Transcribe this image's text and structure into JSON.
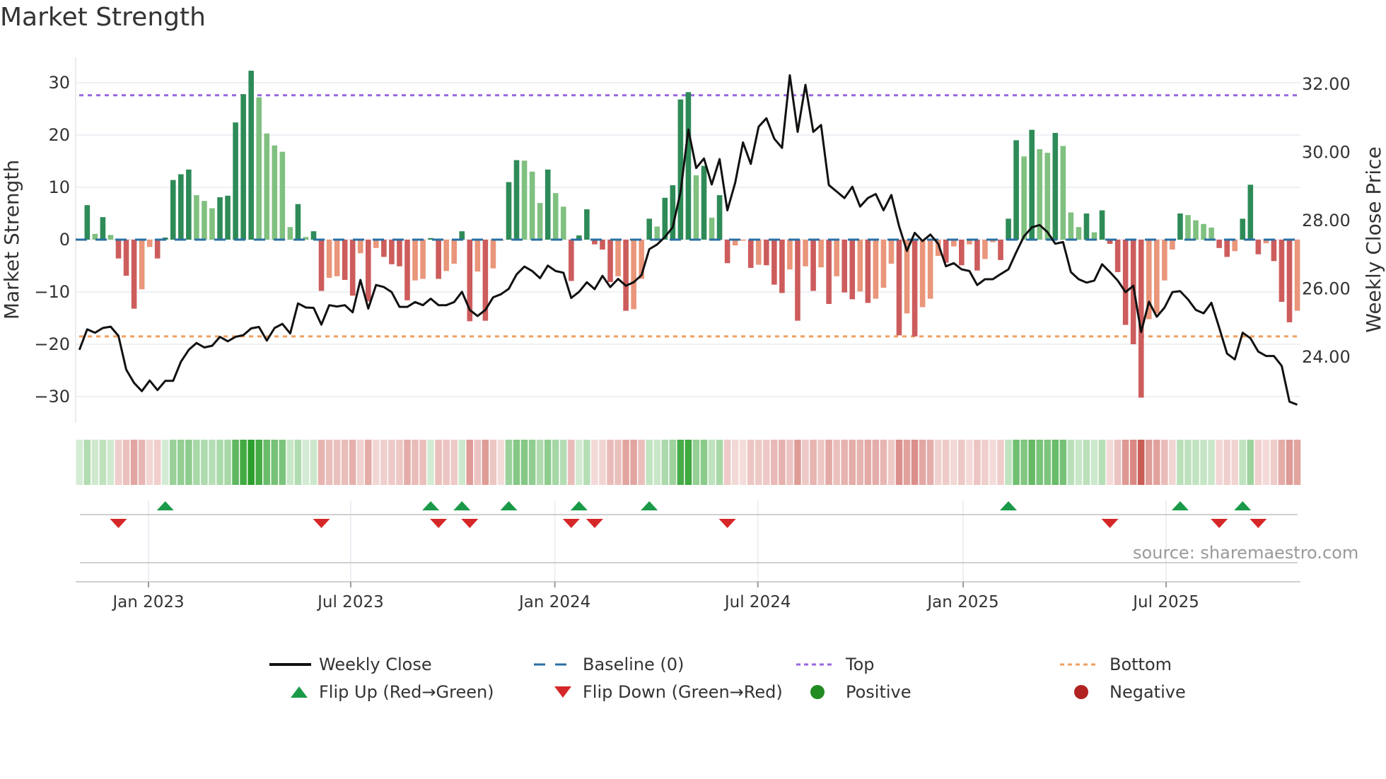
{
  "title": "Market Strength",
  "source": "source: sharemaestro.com",
  "colors": {
    "bar_pos_up": "#2e8b57",
    "bar_pos_down": "#80c080",
    "bar_neg_down": "#cd5c5c",
    "bar_neg_up": "#e9967a",
    "close_line": "#111111",
    "baseline": "#2a6fa3",
    "top": "#9966dd",
    "bottom": "#f0a060",
    "flip_up": "#1a9a48",
    "flip_down": "#d62728",
    "positive": "#228b22",
    "negative": "#b22222",
    "heat_green": "#2ca02c",
    "heat_red": "#c8564e"
  },
  "legend": [
    {
      "label": "Weekly Close",
      "symbol": "line"
    },
    {
      "label": "Baseline (0)",
      "symbol": "dash"
    },
    {
      "label": "Top",
      "symbol": "dot-purple"
    },
    {
      "label": "Bottom",
      "symbol": "dot-orange"
    },
    {
      "label": "Flip Up (Red→Green)",
      "symbol": "triangle-up"
    },
    {
      "label": "Flip Down (Green→Red)",
      "symbol": "triangle-down"
    },
    {
      "label": "Positive",
      "symbol": "dot-green"
    },
    {
      "label": "Negative",
      "symbol": "dot-red"
    }
  ],
  "chart_data": {
    "type": "bar",
    "title": "Market Strength",
    "ylabel": "Market Strength",
    "y2label": "Weekly Close Price",
    "ylim": [
      -38,
      38
    ],
    "yticks": [
      30,
      20,
      10,
      0,
      -10,
      -20,
      -30
    ],
    "ytick_labels": [
      "30",
      "20",
      "10",
      "0",
      "−10",
      "−20",
      "−30"
    ],
    "y2lim": [
      22.45,
      32.38
    ],
    "y2ticks": [
      32,
      30,
      28,
      26,
      24
    ],
    "y2tick_labels": [
      "32.00",
      "30.00",
      "28.00",
      "26.00",
      "24.00"
    ],
    "x_unit": "week",
    "x_ticks": [
      {
        "label": "Jan 2023",
        "week": 8.85
      },
      {
        "label": "Jul 2023",
        "week": 34.75
      },
      {
        "label": "Jan 2024",
        "week": 60.9
      },
      {
        "label": "Jul 2024",
        "week": 86.9
      },
      {
        "label": "Jan 2025",
        "week": 113.2
      },
      {
        "label": "Jul 2025",
        "week": 139.2
      }
    ],
    "top": 27.6,
    "bottom": -18.5,
    "baseline": 0,
    "strength": [
      0.2,
      6.6,
      1.1,
      4.3,
      0.9,
      -3.6,
      -6.9,
      -13.2,
      -9.5,
      -1.4,
      -3.6,
      0.4,
      11.4,
      12.5,
      13.4,
      8.5,
      7.4,
      6.0,
      8.1,
      8.4,
      22.4,
      27.8,
      32.3,
      27.2,
      20.3,
      18.0,
      16.8,
      2.4,
      6.8,
      0.5,
      1.6,
      -9.8,
      -7.3,
      -7.0,
      -7.7,
      -10.7,
      -2.6,
      -11.8,
      -1.6,
      -3.3,
      -4.7,
      -5.1,
      -11.6,
      -7.8,
      -7.5,
      0.3,
      -7.5,
      -6.0,
      -4.6,
      1.6,
      -15.6,
      -6.1,
      -15.5,
      -5.5,
      -0.2,
      11.0,
      15.2,
      15.1,
      13.0,
      7.0,
      13.4,
      8.9,
      6.3,
      -7.9,
      0.8,
      5.8,
      -0.9,
      -1.9,
      -8.1,
      -7.0,
      -13.6,
      -13.3,
      -7.5,
      4.0,
      2.5,
      8.0,
      10.4,
      26.8,
      28.2,
      12.3,
      14.1,
      4.2,
      8.5,
      -4.5,
      -1.1,
      -0.2,
      -5.4,
      -4.8,
      -4.9,
      -8.6,
      -10.2,
      -5.7,
      -15.5,
      -5.1,
      -9.8,
      -5.3,
      -12.3,
      -7.0,
      -10.1,
      -11.4,
      -9.9,
      -12.1,
      -11.3,
      -9.2,
      -4.6,
      -18.3,
      -14.1,
      -18.5,
      -12.9,
      -11.3,
      -3.1,
      -4.4,
      -1.3,
      -4.9,
      -0.9,
      -5.9,
      -3.7,
      -0.5,
      -3.9,
      4.0,
      19.0,
      15.9,
      21.0,
      17.3,
      16.6,
      20.4,
      17.9,
      5.2,
      2.4,
      5.0,
      1.4,
      5.6,
      -0.8,
      -6.2,
      -16.3,
      -20.0,
      -30.2,
      -15.2,
      -14.1,
      -7.8,
      -1.9,
      5.0,
      4.7,
      3.7,
      3.0,
      2.3,
      -1.6,
      -3.3,
      -2.2,
      4.0,
      10.5,
      -2.8,
      -0.7,
      -4.1,
      -11.9,
      -15.8,
      -13.6
    ],
    "weekly_close": [
      24.21,
      24.81,
      24.71,
      24.85,
      24.89,
      24.62,
      23.63,
      23.24,
      23.0,
      23.31,
      23.03,
      23.3,
      23.3,
      23.86,
      24.21,
      24.41,
      24.28,
      24.33,
      24.59,
      24.46,
      24.59,
      24.64,
      24.84,
      24.88,
      24.48,
      24.85,
      24.97,
      24.69,
      25.57,
      25.45,
      25.44,
      24.95,
      25.52,
      25.48,
      25.52,
      25.31,
      26.26,
      25.42,
      26.11,
      26.05,
      25.9,
      25.47,
      25.47,
      25.61,
      25.52,
      25.71,
      25.52,
      25.52,
      25.61,
      25.91,
      25.38,
      25.2,
      25.38,
      25.75,
      25.84,
      26.0,
      26.42,
      26.65,
      26.52,
      26.31,
      26.68,
      26.52,
      26.47,
      25.73,
      25.91,
      26.19,
      25.99,
      26.38,
      26.05,
      26.29,
      26.09,
      26.19,
      26.4,
      27.16,
      27.3,
      27.52,
      27.8,
      28.84,
      30.67,
      29.54,
      29.82,
      29.06,
      29.8,
      28.3,
      29.11,
      30.29,
      29.66,
      30.75,
      31.0,
      30.4,
      30.13,
      32.26,
      30.6,
      31.98,
      30.6,
      30.8,
      29.04,
      28.85,
      28.66,
      28.99,
      28.41,
      28.66,
      28.78,
      28.3,
      28.75,
      27.83,
      27.11,
      27.64,
      27.4,
      27.59,
      27.32,
      26.66,
      26.75,
      26.57,
      26.52,
      26.11,
      26.28,
      26.28,
      26.43,
      26.57,
      27.07,
      27.54,
      27.8,
      27.87,
      27.66,
      27.32,
      27.37,
      26.49,
      26.28,
      26.18,
      26.24,
      26.72,
      26.49,
      26.24,
      25.9,
      26.09,
      24.73,
      25.62,
      25.18,
      25.45,
      25.9,
      25.93,
      25.69,
      25.38,
      25.28,
      25.59,
      24.86,
      24.1,
      23.93,
      24.71,
      24.55,
      24.16,
      24.03,
      24.03,
      23.74,
      22.69,
      22.6
    ],
    "flip_up_weeks": [
      11,
      45,
      49,
      55,
      64,
      73,
      119,
      141,
      149
    ],
    "flip_down_weeks": [
      5,
      31,
      46,
      50,
      63,
      66,
      83,
      132,
      146,
      151
    ],
    "grid": true,
    "legend_position": "bottom"
  }
}
